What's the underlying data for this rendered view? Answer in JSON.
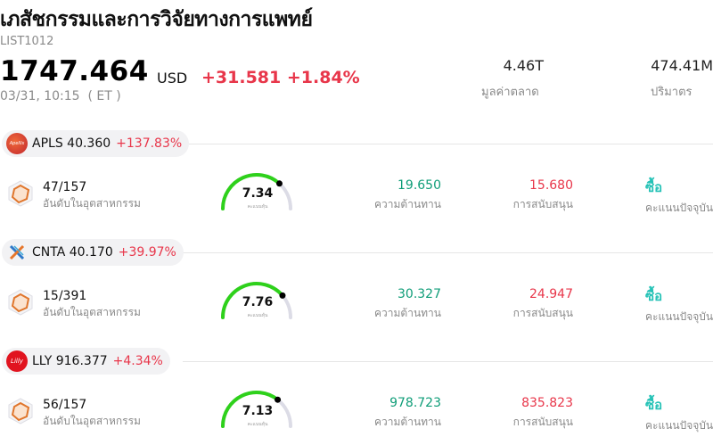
{
  "header": {
    "title": "เภสัชกรรมและการวิจัยทางการแพทย์",
    "code": "LIST1012",
    "price": "1747.464",
    "currency": "USD",
    "change": "+31.581",
    "change_pct": "+1.84%",
    "time": "03/31, 10:15  ( ET )",
    "market_cap_value": "4.46T",
    "market_cap_label": "มูลค่าตลาด",
    "volume_value": "474.41M",
    "volume_label": "ปริมาตร"
  },
  "stocks": [
    {
      "ticker": "APLS 40.360",
      "change_pct": "+137.83%",
      "logo_text": "Apellis",
      "rank": "47/157",
      "rank_label": "อันดับในอุตสาหกรรม",
      "score": "7.34",
      "score_level": 7.34,
      "score_max": 10,
      "score_label": "คะแนนหุ้น",
      "resistance": "19.650",
      "resistance_label": "ความต้านทาน",
      "support": "15.680",
      "support_label": "การสนับสนุน",
      "rating": "ซื้อ",
      "rating_label": "คะแนนปัจจุบัน"
    },
    {
      "ticker": "CNTA 40.170",
      "change_pct": "+39.97%",
      "logo_text": "",
      "rank": "15/391",
      "rank_label": "อันดับในอุตสาหกรรม",
      "score": "7.76",
      "score_level": 7.76,
      "score_max": 10,
      "score_label": "คะแนนหุ้น",
      "resistance": "30.327",
      "resistance_label": "ความต้านทาน",
      "support": "24.947",
      "support_label": "การสนับสนุน",
      "rating": "ซื้อ",
      "rating_label": "คะแนนปัจจุบัน"
    },
    {
      "ticker": "LLY 916.377",
      "change_pct": "+4.34%",
      "logo_text": "Lilly",
      "rank": "56/157",
      "rank_label": "อันดับในอุตสาหกรรม",
      "score": "7.13",
      "score_level": 7.13,
      "score_max": 10,
      "score_label": "คะแนนหุ้น",
      "resistance": "978.723",
      "resistance_label": "ความต้านทาน",
      "support": "835.823",
      "support_label": "การสนับสนุน",
      "rating": "ซื้อ",
      "rating_label": "คะแนนปัจจุบัน"
    }
  ],
  "colors": {
    "up": "#e8364a",
    "resistance": "#0f9d78",
    "buy": "#25c2b6",
    "gauge_fill": "#2ed11b",
    "gauge_track": "#dcdce6"
  }
}
